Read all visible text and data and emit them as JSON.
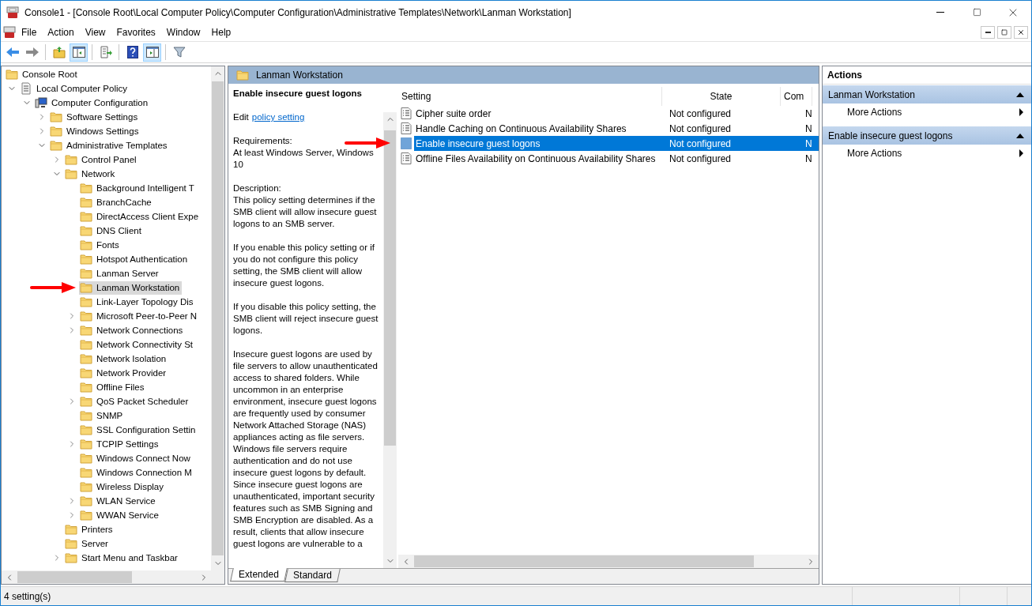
{
  "window": {
    "title": "Console1 - [Console Root\\Local Computer Policy\\Computer Configuration\\Administrative Templates\\Network\\Lanman Workstation]"
  },
  "menu": [
    "File",
    "Action",
    "View",
    "Favorites",
    "Window",
    "Help"
  ],
  "toolbar": [
    [
      {
        "kind": "back",
        "pressed": false
      },
      {
        "kind": "forward",
        "pressed": false
      }
    ],
    [
      {
        "kind": "up",
        "pressed": false
      },
      {
        "kind": "tree",
        "pressed": true
      }
    ],
    [
      {
        "kind": "export",
        "pressed": false
      }
    ],
    [
      {
        "kind": "help",
        "pressed": false
      },
      {
        "kind": "actions",
        "pressed": true
      }
    ],
    [
      {
        "kind": "filter",
        "pressed": false
      }
    ]
  ],
  "tree": [
    {
      "label": "Console Root",
      "kind": "folder",
      "expandable": false,
      "selected": false,
      "arrow": false,
      "children": [
        {
          "label": "Local Computer Policy",
          "kind": "policy",
          "expandable": true,
          "expanded": true,
          "selected": false,
          "arrow": false,
          "children": [
            {
              "label": "Computer Configuration",
              "kind": "computer",
              "expandable": true,
              "expanded": true,
              "selected": false,
              "arrow": false,
              "children": [
                {
                  "label": "Software Settings",
                  "kind": "folder",
                  "expandable": true,
                  "expanded": false,
                  "selected": false,
                  "arrow": false
                },
                {
                  "label": "Windows Settings",
                  "kind": "folder",
                  "expandable": true,
                  "expanded": false,
                  "selected": false,
                  "arrow": false
                },
                {
                  "label": "Administrative Templates",
                  "kind": "folder",
                  "expandable": true,
                  "expanded": true,
                  "selected": false,
                  "arrow": false,
                  "children": [
                    {
                      "label": "Control Panel",
                      "kind": "folder",
                      "expandable": true,
                      "expanded": false,
                      "selected": false,
                      "arrow": false
                    },
                    {
                      "label": "Network",
                      "kind": "folder",
                      "expandable": true,
                      "expanded": true,
                      "selected": false,
                      "arrow": false,
                      "children": [
                        {
                          "label": "Background Intelligent T",
                          "kind": "folder",
                          "expandable": false,
                          "selected": false,
                          "arrow": false
                        },
                        {
                          "label": "BranchCache",
                          "kind": "folder",
                          "expandable": false,
                          "selected": false,
                          "arrow": false
                        },
                        {
                          "label": "DirectAccess Client Expe",
                          "kind": "folder",
                          "expandable": false,
                          "selected": false,
                          "arrow": false
                        },
                        {
                          "label": "DNS Client",
                          "kind": "folder",
                          "expandable": false,
                          "selected": false,
                          "arrow": false
                        },
                        {
                          "label": "Fonts",
                          "kind": "folder",
                          "expandable": false,
                          "selected": false,
                          "arrow": false
                        },
                        {
                          "label": "Hotspot Authentication",
                          "kind": "folder",
                          "expandable": false,
                          "selected": false,
                          "arrow": false
                        },
                        {
                          "label": "Lanman Server",
                          "kind": "folder",
                          "expandable": false,
                          "selected": false,
                          "arrow": false
                        },
                        {
                          "label": "Lanman Workstation",
                          "kind": "folder",
                          "expandable": false,
                          "selected": true,
                          "arrow": true
                        },
                        {
                          "label": "Link-Layer Topology Dis",
                          "kind": "folder",
                          "expandable": false,
                          "selected": false,
                          "arrow": false
                        },
                        {
                          "label": "Microsoft Peer-to-Peer N",
                          "kind": "folder",
                          "expandable": true,
                          "expanded": false,
                          "selected": false,
                          "arrow": false
                        },
                        {
                          "label": "Network Connections",
                          "kind": "folder",
                          "expandable": true,
                          "expanded": false,
                          "selected": false,
                          "arrow": false
                        },
                        {
                          "label": "Network Connectivity St",
                          "kind": "folder",
                          "expandable": false,
                          "selected": false,
                          "arrow": false
                        },
                        {
                          "label": "Network Isolation",
                          "kind": "folder",
                          "expandable": false,
                          "selected": false,
                          "arrow": false
                        },
                        {
                          "label": "Network Provider",
                          "kind": "folder",
                          "expandable": false,
                          "selected": false,
                          "arrow": false
                        },
                        {
                          "label": "Offline Files",
                          "kind": "folder",
                          "expandable": false,
                          "selected": false,
                          "arrow": false
                        },
                        {
                          "label": "QoS Packet Scheduler",
                          "kind": "folder",
                          "expandable": true,
                          "expanded": false,
                          "selected": false,
                          "arrow": false
                        },
                        {
                          "label": "SNMP",
                          "kind": "folder",
                          "expandable": false,
                          "selected": false,
                          "arrow": false
                        },
                        {
                          "label": "SSL Configuration Settin",
                          "kind": "folder",
                          "expandable": false,
                          "selected": false,
                          "arrow": false
                        },
                        {
                          "label": "TCPIP Settings",
                          "kind": "folder",
                          "expandable": true,
                          "expanded": false,
                          "selected": false,
                          "arrow": false
                        },
                        {
                          "label": "Windows Connect Now",
                          "kind": "folder",
                          "expandable": false,
                          "selected": false,
                          "arrow": false
                        },
                        {
                          "label": "Windows Connection M",
                          "kind": "folder",
                          "expandable": false,
                          "selected": false,
                          "arrow": false
                        },
                        {
                          "label": "Wireless Display",
                          "kind": "folder",
                          "expandable": false,
                          "selected": false,
                          "arrow": false
                        },
                        {
                          "label": "WLAN Service",
                          "kind": "folder",
                          "expandable": true,
                          "expanded": false,
                          "selected": false,
                          "arrow": false
                        },
                        {
                          "label": "WWAN Service",
                          "kind": "folder",
                          "expandable": true,
                          "expanded": false,
                          "selected": false,
                          "arrow": false
                        }
                      ]
                    },
                    {
                      "label": "Printers",
                      "kind": "folder",
                      "expandable": false,
                      "selected": false,
                      "arrow": false
                    },
                    {
                      "label": "Server",
                      "kind": "folder",
                      "expandable": false,
                      "selected": false,
                      "arrow": false
                    },
                    {
                      "label": "Start Menu and Taskbar",
                      "kind": "folder",
                      "expandable": true,
                      "expanded": false,
                      "selected": false,
                      "arrow": false
                    }
                  ]
                }
              ]
            }
          ]
        }
      ]
    }
  ],
  "band": {
    "title": "Lanman Workstation"
  },
  "details": {
    "title": "Enable insecure guest logons",
    "edit_prefix": "Edit",
    "edit_link": "policy setting",
    "requirements_label": "Requirements:",
    "requirements": "At least Windows Server, Windows 10",
    "description_label": "Description:",
    "paragraphs": [
      "This policy setting determines if the SMB client will allow insecure guest logons to an SMB server.",
      "If you enable this policy setting or if you do not configure this policy setting, the SMB client will allow insecure guest logons.",
      "If you disable this policy setting, the SMB client will reject insecure guest logons.",
      "Insecure guest logons are used by file servers to allow unauthenticated access to shared folders. While uncommon in an enterprise environment, insecure guest logons are frequently used by consumer Network Attached Storage (NAS) appliances acting as file servers. Windows file servers require authentication and do not use insecure guest logons by default. Since insecure guest logons are unauthenticated, important security features such as SMB Signing and SMB Encryption are disabled. As a result, clients that allow insecure guest logons are vulnerable to a"
    ]
  },
  "table": {
    "columns": [
      "Setting",
      "State",
      "Com"
    ],
    "rows": [
      {
        "cells": [
          "Cipher suite order",
          "Not configured",
          "N"
        ],
        "selected": false,
        "arrow": false
      },
      {
        "cells": [
          "Handle Caching on Continuous Availability Shares",
          "Not configured",
          "N"
        ],
        "selected": false,
        "arrow": false
      },
      {
        "cells": [
          "Enable insecure guest logons",
          "Not configured",
          "N"
        ],
        "selected": true,
        "arrow": true
      },
      {
        "cells": [
          "Offline Files Availability on Continuous Availability Shares",
          "Not configured",
          "N"
        ],
        "selected": false,
        "arrow": false
      }
    ]
  },
  "tabs": [
    {
      "label": "Extended",
      "selected": true
    },
    {
      "label": "Standard",
      "selected": false
    }
  ],
  "actions": {
    "title": "Actions",
    "sections": [
      {
        "title": "Lanman Workstation",
        "expanded": true,
        "items": [
          "More Actions"
        ]
      },
      {
        "title": "Enable insecure guest logons",
        "expanded": true,
        "items": [
          "More Actions"
        ]
      }
    ]
  },
  "status_bar": {
    "text": "4 setting(s)"
  }
}
